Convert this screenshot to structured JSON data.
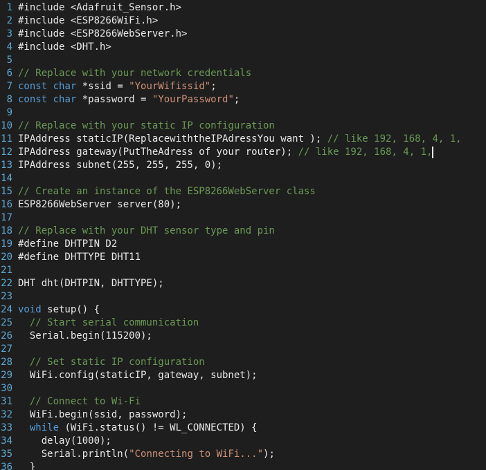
{
  "editor": {
    "lines": [
      {
        "n": "1",
        "segs": [
          {
            "t": "#include <Adafruit_Sensor.h>",
            "c": "code"
          }
        ]
      },
      {
        "n": "2",
        "segs": [
          {
            "t": "#include <ESP8266WiFi.h>",
            "c": "code"
          }
        ]
      },
      {
        "n": "3",
        "segs": [
          {
            "t": "#include <ESP8266WebServer.h>",
            "c": "code"
          }
        ]
      },
      {
        "n": "4",
        "segs": [
          {
            "t": "#include <DHT.h>",
            "c": "code"
          }
        ]
      },
      {
        "n": "5",
        "segs": []
      },
      {
        "n": "6",
        "segs": [
          {
            "t": "// Replace with your network credentials",
            "c": "cm"
          }
        ]
      },
      {
        "n": "7",
        "segs": [
          {
            "t": "const",
            "c": "kw"
          },
          {
            "t": " ",
            "c": "code"
          },
          {
            "t": "char",
            "c": "kw"
          },
          {
            "t": " *ssid = ",
            "c": "code"
          },
          {
            "t": "\"YourWifissid\"",
            "c": "str"
          },
          {
            "t": ";",
            "c": "code"
          }
        ]
      },
      {
        "n": "8",
        "segs": [
          {
            "t": "const",
            "c": "kw"
          },
          {
            "t": " ",
            "c": "code"
          },
          {
            "t": "char",
            "c": "kw"
          },
          {
            "t": " *password = ",
            "c": "code"
          },
          {
            "t": "\"YourPassword\"",
            "c": "str"
          },
          {
            "t": ";",
            "c": "code"
          }
        ]
      },
      {
        "n": "9",
        "segs": []
      },
      {
        "n": "10",
        "segs": [
          {
            "t": "// Replace with your static IP configuration",
            "c": "cm"
          }
        ]
      },
      {
        "n": "11",
        "segs": [
          {
            "t": "IPAddress staticIP(ReplacewiththeIPAdressYou want ); ",
            "c": "code"
          },
          {
            "t": "// like 192, 168, 4, 1,",
            "c": "cm"
          }
        ]
      },
      {
        "n": "12",
        "segs": [
          {
            "t": "IPAddress gateway(PutTheAdress of your router); ",
            "c": "code"
          },
          {
            "t": "// like 192, 168, 4, 1,",
            "c": "cm"
          }
        ]
      },
      {
        "n": "13",
        "segs": [
          {
            "t": "IPAddress subnet(255, 255, 255, 0);",
            "c": "code"
          }
        ]
      },
      {
        "n": "14",
        "segs": []
      },
      {
        "n": "15",
        "segs": [
          {
            "t": "// Create an instance of the ESP8266WebServer class",
            "c": "cm"
          }
        ]
      },
      {
        "n": "16",
        "segs": [
          {
            "t": "ESP8266WebServer server(80);",
            "c": "code"
          }
        ]
      },
      {
        "n": "17",
        "segs": []
      },
      {
        "n": "18",
        "segs": [
          {
            "t": "// Replace with your DHT sensor type and pin",
            "c": "cm"
          }
        ]
      },
      {
        "n": "19",
        "segs": [
          {
            "t": "#define DHTPIN D2",
            "c": "code"
          }
        ]
      },
      {
        "n": "20",
        "segs": [
          {
            "t": "#define DHTTYPE DHT11",
            "c": "code"
          }
        ]
      },
      {
        "n": "21",
        "segs": []
      },
      {
        "n": "22",
        "segs": [
          {
            "t": "DHT dht(DHTPIN, DHTTYPE);",
            "c": "code"
          }
        ]
      },
      {
        "n": "23",
        "segs": []
      },
      {
        "n": "24",
        "segs": [
          {
            "t": "void",
            "c": "kw"
          },
          {
            "t": " setup() {",
            "c": "code"
          }
        ]
      },
      {
        "n": "25",
        "segs": [
          {
            "t": "  ",
            "c": "code"
          },
          {
            "t": "// Start serial communication",
            "c": "cm"
          }
        ]
      },
      {
        "n": "26",
        "segs": [
          {
            "t": "  Serial.begin(115200);",
            "c": "code"
          }
        ]
      },
      {
        "n": "27",
        "segs": []
      },
      {
        "n": "28",
        "segs": [
          {
            "t": "  ",
            "c": "code"
          },
          {
            "t": "// Set static IP configuration",
            "c": "cm"
          }
        ]
      },
      {
        "n": "29",
        "segs": [
          {
            "t": "  WiFi.config(staticIP, gateway, subnet);",
            "c": "code"
          }
        ]
      },
      {
        "n": "30",
        "segs": []
      },
      {
        "n": "31",
        "segs": [
          {
            "t": "  ",
            "c": "code"
          },
          {
            "t": "// Connect to Wi-Fi",
            "c": "cm"
          }
        ]
      },
      {
        "n": "32",
        "segs": [
          {
            "t": "  WiFi.begin(ssid, password);",
            "c": "code"
          }
        ]
      },
      {
        "n": "33",
        "segs": [
          {
            "t": "  ",
            "c": "code"
          },
          {
            "t": "while",
            "c": "kw"
          },
          {
            "t": " (WiFi.status() != WL_CONNECTED) {",
            "c": "code"
          }
        ]
      },
      {
        "n": "34",
        "segs": [
          {
            "t": "    delay(1000);",
            "c": "code"
          }
        ]
      },
      {
        "n": "35",
        "segs": [
          {
            "t": "    Serial.println(",
            "c": "code"
          },
          {
            "t": "\"Connecting to WiFi...\"",
            "c": "str"
          },
          {
            "t": ");",
            "c": "code"
          }
        ]
      },
      {
        "n": "36",
        "segs": [
          {
            "t": "  }",
            "c": "code"
          }
        ]
      }
    ],
    "caret_line": 12
  }
}
